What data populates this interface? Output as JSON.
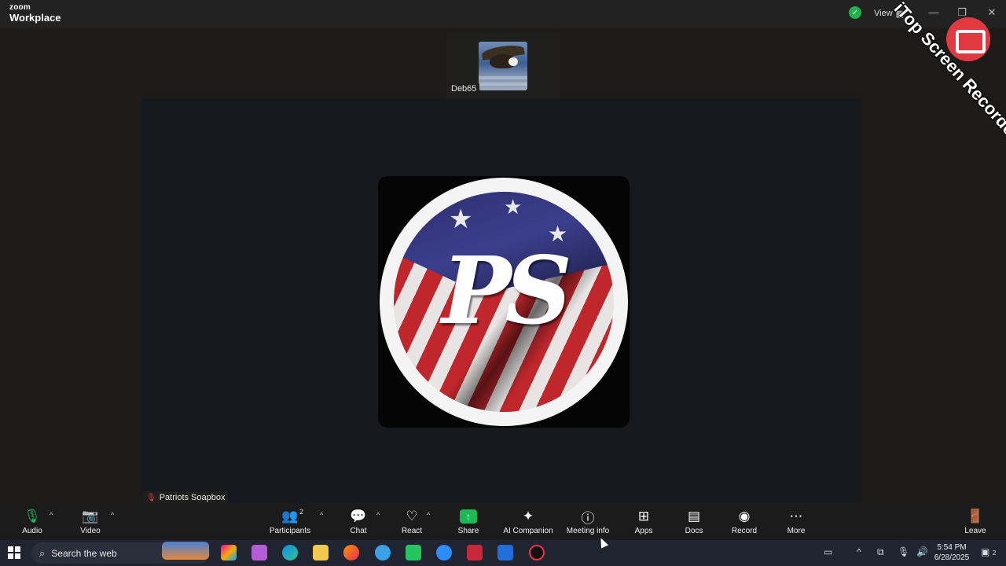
{
  "window": {
    "brand_small": "zoom",
    "brand_large": "Workplace",
    "view_label": "View",
    "controls": {
      "minimize": "—",
      "restore": "❐",
      "close": "✕"
    }
  },
  "stage": {
    "thumbnail_participant": "Deb65",
    "speaker_name": "Patriots Soapbox",
    "avatar_monogram": "PS"
  },
  "watermark": {
    "text": "iTop Screen Recorder"
  },
  "toolbar": {
    "audio": "Audio",
    "video": "Video",
    "participants": "Participants",
    "participants_count": "2",
    "chat": "Chat",
    "react": "React",
    "share": "Share",
    "ai_companion": "AI Companion",
    "meeting_info": "Meeting info",
    "apps": "Apps",
    "docs": "Docs",
    "record": "Record",
    "more": "More",
    "leave": "Leave"
  },
  "taskbar": {
    "search_placeholder": "Search the web",
    "time": "5:54 PM",
    "date": "6/28/2025",
    "notification_count": "2"
  },
  "colors": {
    "share_green": "#1db954",
    "shield_green": "#22b14c",
    "muted_red": "#e0403a",
    "watermark_red": "#e0393f"
  }
}
